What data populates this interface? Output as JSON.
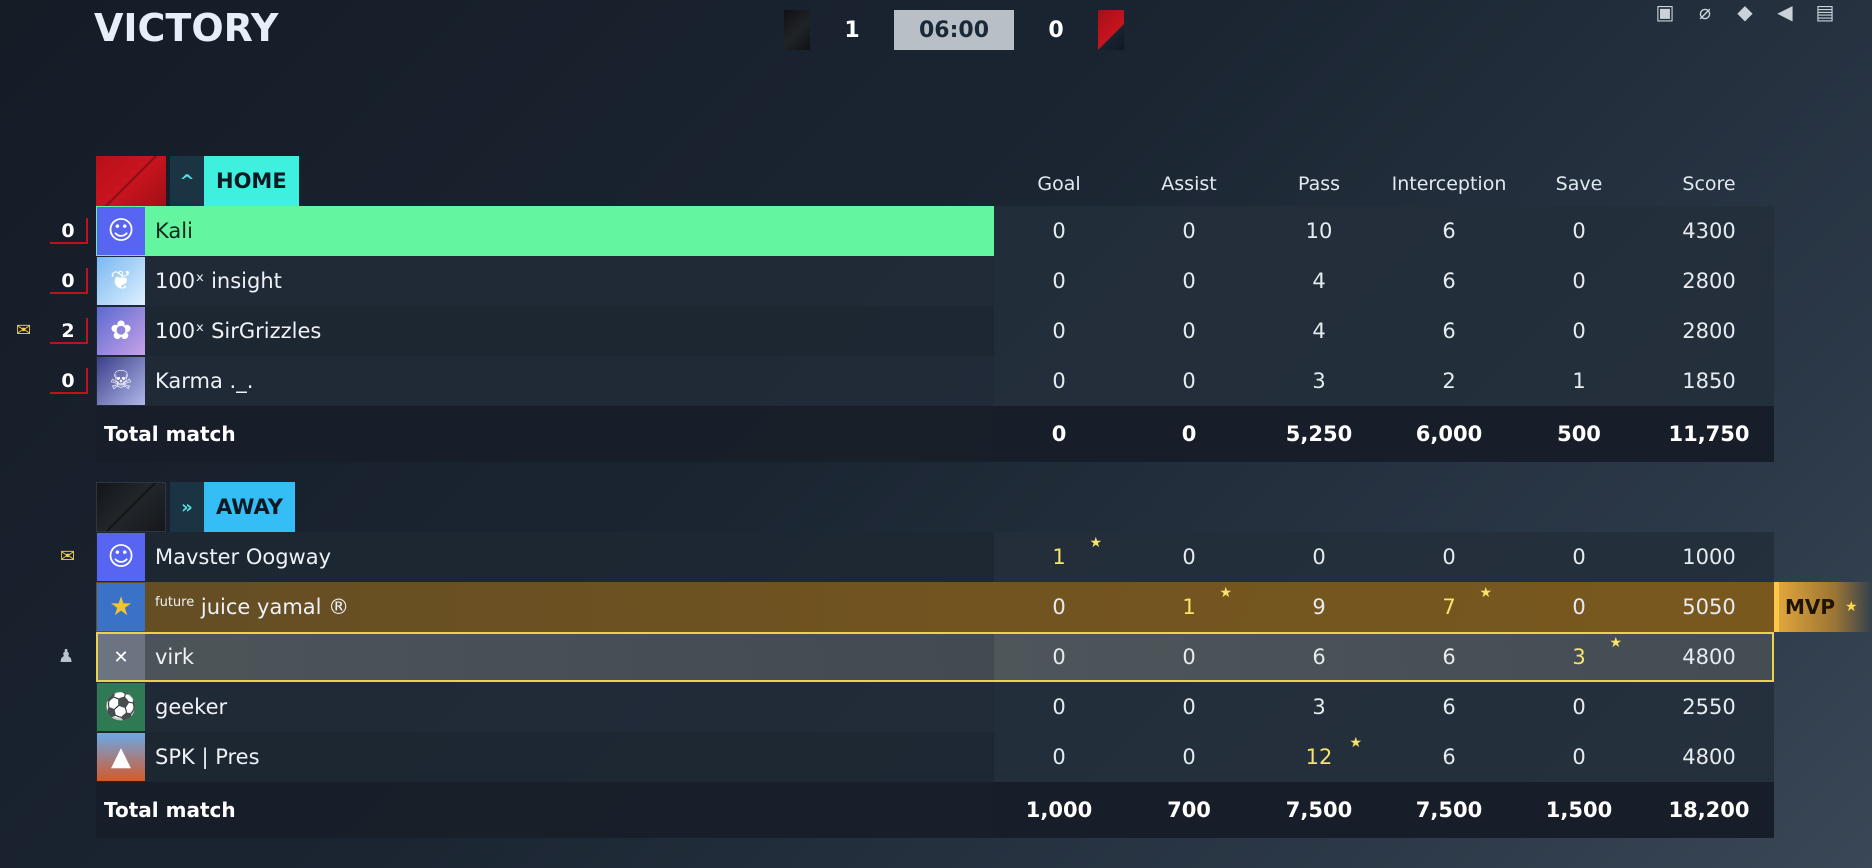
{
  "result": "VICTORY",
  "scoreboard": {
    "home_score": "1",
    "timer": "06:00",
    "away_score": "0"
  },
  "columns": [
    "Goal",
    "Assist",
    "Pass",
    "Interception",
    "Save",
    "Score"
  ],
  "home": {
    "name": "HOME",
    "emblem": "^",
    "players": [
      {
        "prefix": "",
        "name": "Kali",
        "side_num": "0",
        "avatar": "discord-avatar",
        "stats": [
          "0",
          "0",
          "10",
          "6",
          "0",
          "4300"
        ]
      },
      {
        "prefix": "",
        "name": "100ˣ insight",
        "side_num": "0",
        "avatar": "bird-avatar",
        "stats": [
          "0",
          "0",
          "4",
          "6",
          "0",
          "2800"
        ]
      },
      {
        "prefix": "",
        "name": "100ˣ SirGrizzles",
        "side_num": "2",
        "avatar": "fairy-avatar",
        "stats": [
          "0",
          "0",
          "4",
          "6",
          "0",
          "2800"
        ]
      },
      {
        "prefix": "",
        "name": "Karma ._.",
        "side_num": "0",
        "avatar": "skull-avatar",
        "stats": [
          "0",
          "0",
          "3",
          "2",
          "1",
          "1850"
        ]
      }
    ],
    "total_label": "Total match",
    "totals": [
      "0",
      "0",
      "5,250",
      "6,000",
      "500",
      "11,750"
    ]
  },
  "away": {
    "name": "AWAY",
    "emblem": "»",
    "players": [
      {
        "prefix": "",
        "name": "Mavster Oogway",
        "avatar": "discord-avatar",
        "stats": [
          "1",
          "0",
          "0",
          "0",
          "0",
          "1000"
        ]
      },
      {
        "prefix": "future",
        "name": "juice yamal ®",
        "avatar": "star-avatar",
        "stats": [
          "0",
          "1",
          "9",
          "7",
          "0",
          "5050"
        ]
      },
      {
        "prefix": "",
        "name": "virk",
        "avatar": "muted-avatar",
        "stats": [
          "0",
          "0",
          "6",
          "6",
          "3",
          "4800"
        ]
      },
      {
        "prefix": "",
        "name": "geeker",
        "avatar": "ball-avatar",
        "stats": [
          "0",
          "0",
          "3",
          "6",
          "0",
          "2550"
        ]
      },
      {
        "prefix": "",
        "name": "SPK | Pres",
        "avatar": "mountain-avatar",
        "stats": [
          "0",
          "0",
          "12",
          "6",
          "0",
          "4800"
        ]
      }
    ],
    "total_label": "Total match",
    "totals": [
      "1,000",
      "700",
      "7,500",
      "7,500",
      "1,500",
      "18,200"
    ]
  },
  "mvp_label": "MVP",
  "colors": {
    "home_tag": "#3ff0df",
    "away_tag": "#35bdf6",
    "highlight": "#63f59f",
    "gold": "#f5e36a",
    "mvp": "#e0a53c"
  }
}
